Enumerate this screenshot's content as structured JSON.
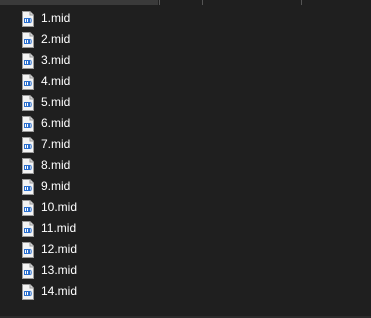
{
  "file_icon": "midi-audio-file-icon",
  "colors": {
    "background": "#1f1f1f",
    "text": "#ffffff",
    "icon_accent": "#2a6fcf"
  },
  "files": [
    {
      "name": "1.mid"
    },
    {
      "name": "2.mid"
    },
    {
      "name": "3.mid"
    },
    {
      "name": "4.mid"
    },
    {
      "name": "5.mid"
    },
    {
      "name": "6.mid"
    },
    {
      "name": "7.mid"
    },
    {
      "name": "8.mid"
    },
    {
      "name": "9.mid"
    },
    {
      "name": "10.mid"
    },
    {
      "name": "11.mid"
    },
    {
      "name": "12.mid"
    },
    {
      "name": "13.mid"
    },
    {
      "name": "14.mid"
    }
  ]
}
